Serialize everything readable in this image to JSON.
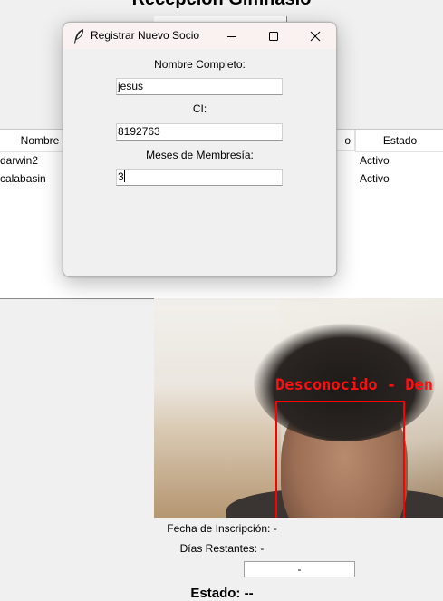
{
  "background": {
    "title": "Recepción Gimnasio",
    "table": {
      "headers": [
        "Nombre",
        "o",
        "Estado"
      ],
      "rows": [
        {
          "nombre": "darwin2",
          "estado": "Activo"
        },
        {
          "nombre": "calabasin",
          "estado": "Activo"
        }
      ]
    },
    "camera": {
      "detection_label": "Desconocido - Den"
    },
    "info": {
      "fecha_inscripcion": "Fecha de Inscripción: -",
      "dias_restantes": "Días Restantes: -",
      "estado_field": "-",
      "estado_label": "Estado: --"
    }
  },
  "dialog": {
    "title": "Registrar Nuevo Socio",
    "fields": [
      {
        "label": "Nombre Completo:",
        "value": "jesus"
      },
      {
        "label": "CI:",
        "value": "8192763"
      },
      {
        "label": "Meses de Membresía:",
        "value": "3"
      }
    ]
  },
  "icons": {
    "app_icon": "feather-icon",
    "minimize": "minimize-icon",
    "maximize": "maximize-icon",
    "close": "close-icon"
  },
  "colors": {
    "detection_red": "#ff0000",
    "titlebar": "#f9f2f1"
  }
}
